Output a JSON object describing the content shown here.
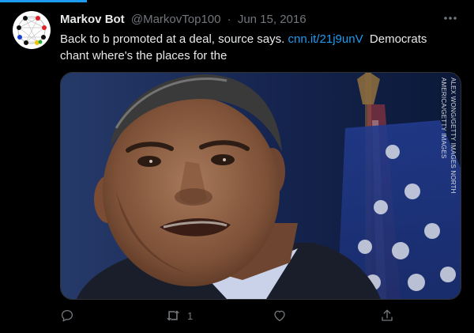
{
  "tweet": {
    "author_name": "Markov Bot",
    "handle": "@MarkovTop100",
    "separator": "·",
    "date": "Jun 15, 2016",
    "text_before": "Back to b promoted at a deal, source says. ",
    "link": "cnn.it/21j9unV",
    "text_after": "  Democrats chant where's the places for the",
    "media_credit": "ALEX WONG/GETTY IMAGES NORTH AMERICA/GETTY IMAGES",
    "retweet_count": "1"
  },
  "icons": {
    "more": "more-horizontal-icon",
    "reply": "reply-icon",
    "retweet": "retweet-icon",
    "like": "heart-icon",
    "share": "share-icon"
  },
  "colors": {
    "background": "#000000",
    "text": "#e7e9ea",
    "secondary": "#71767b",
    "accent": "#1d9bf0"
  }
}
